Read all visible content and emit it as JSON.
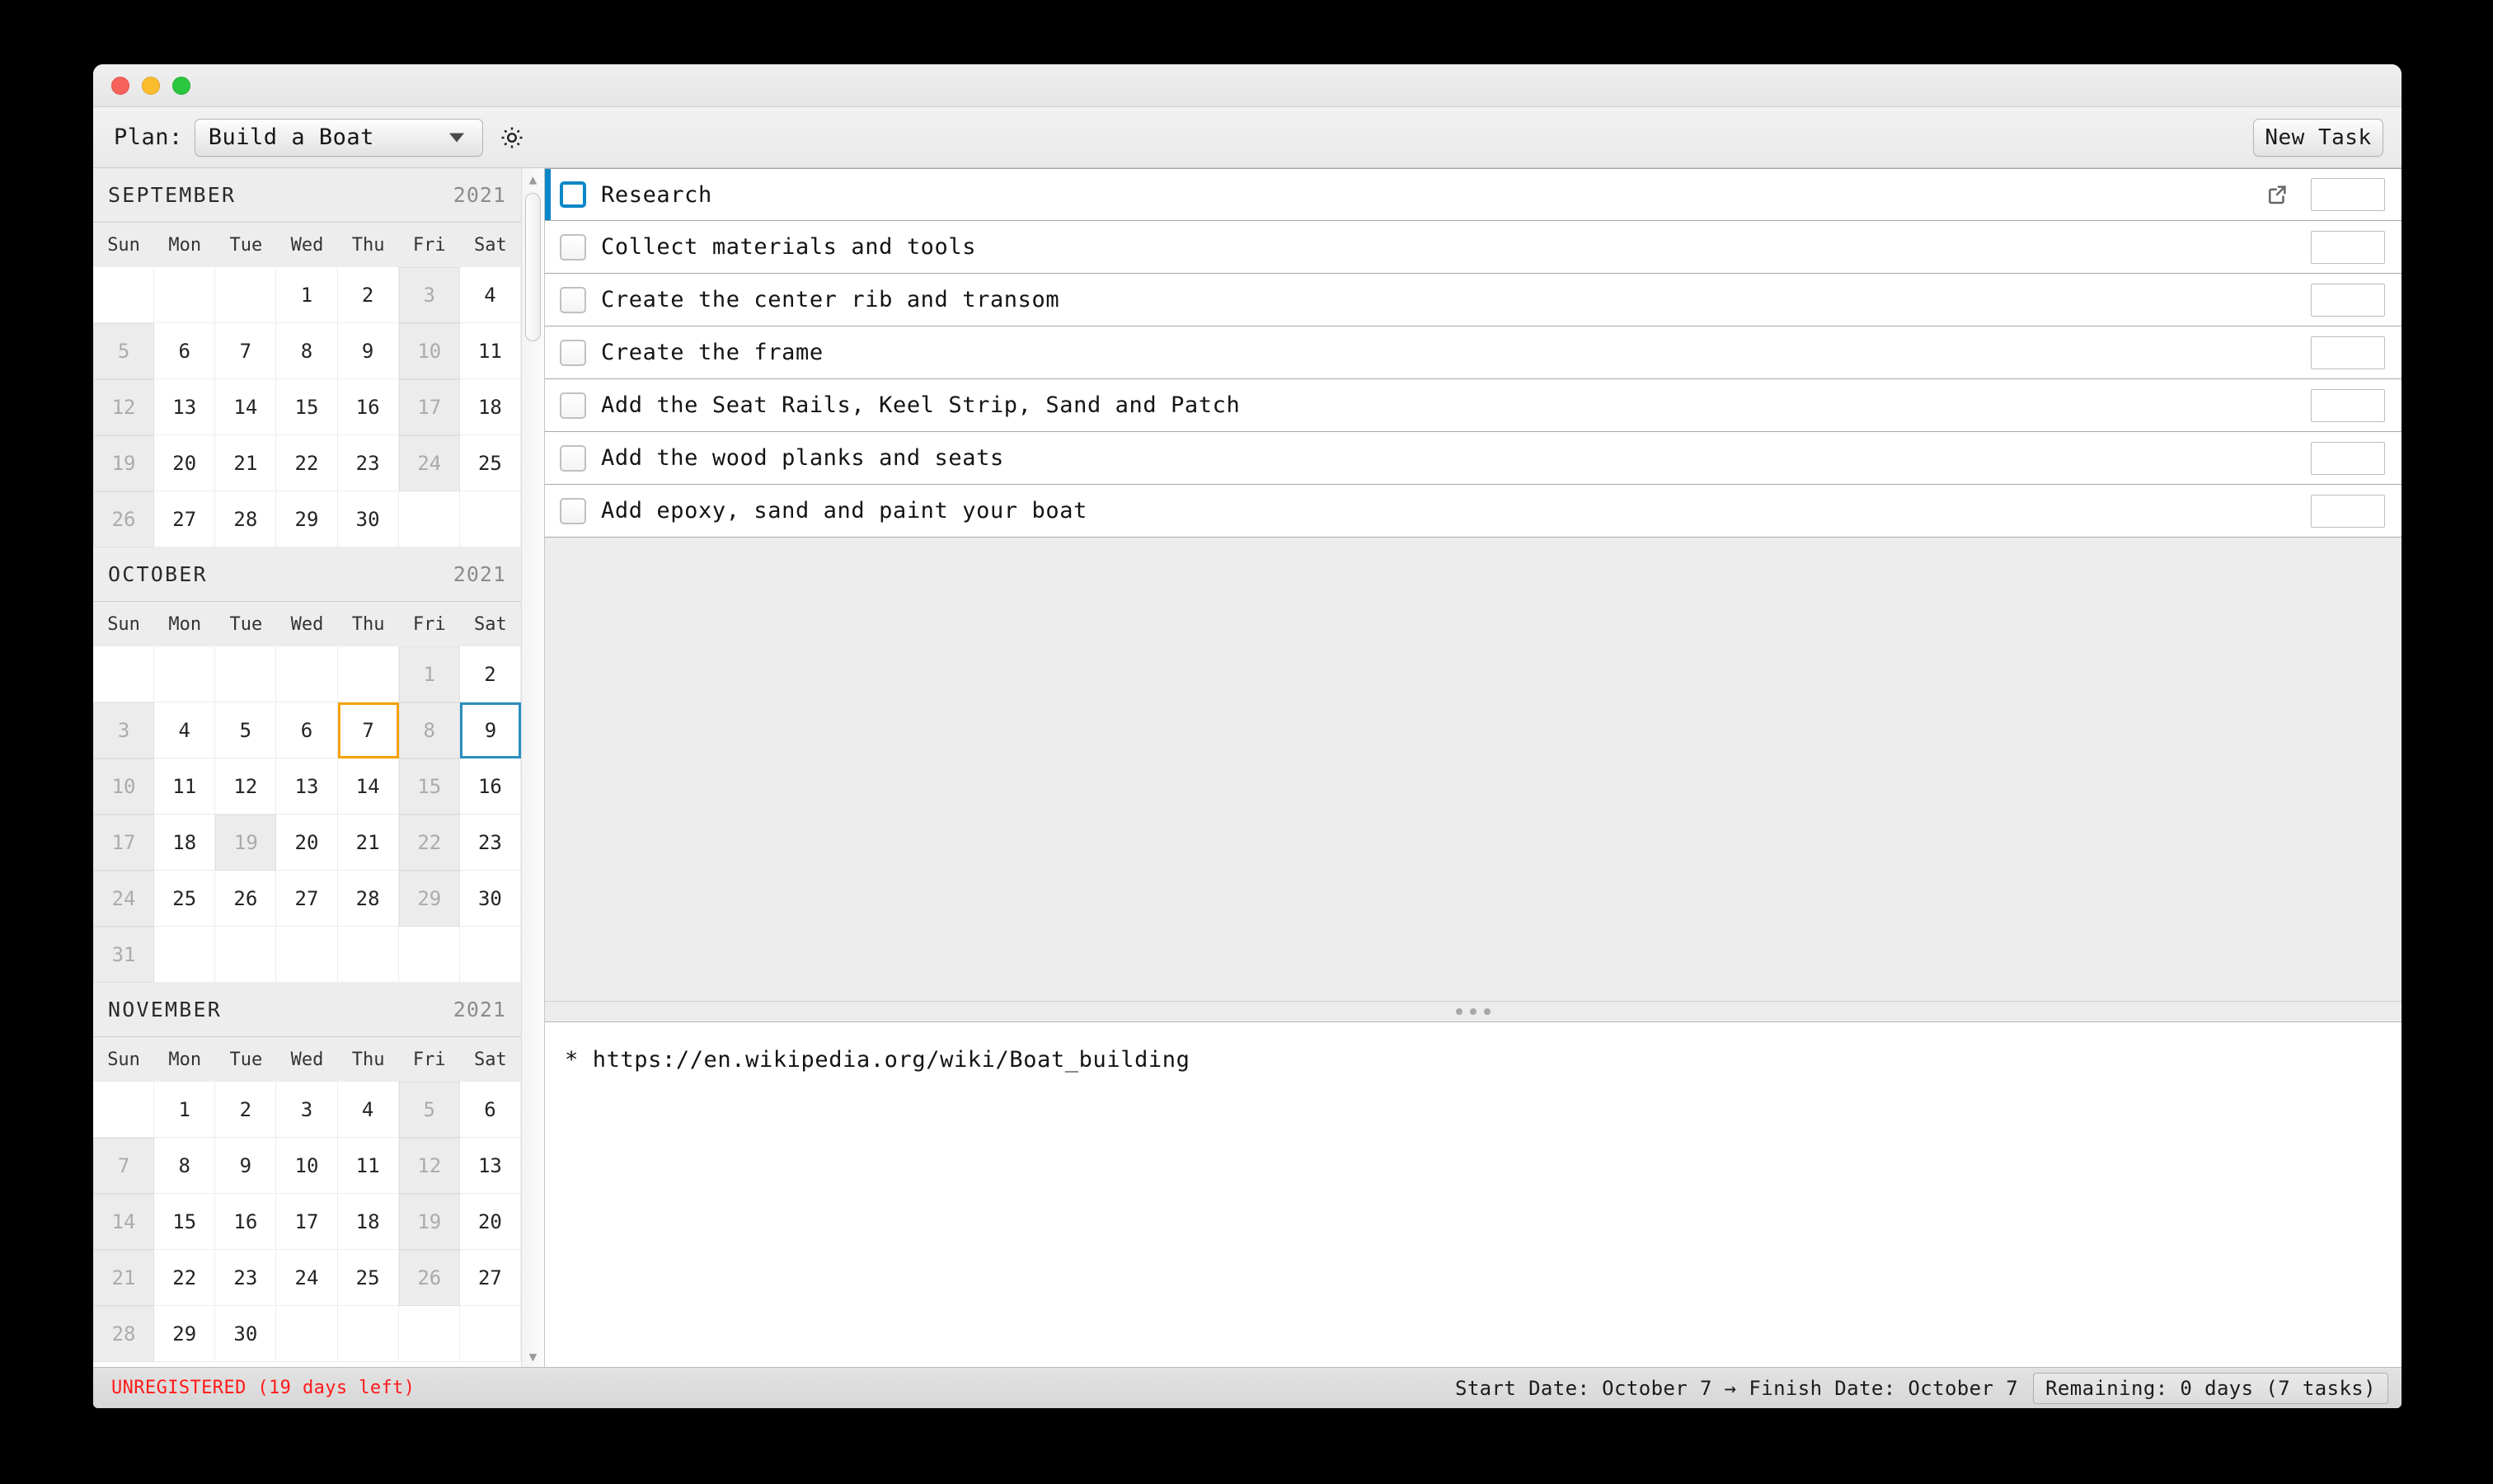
{
  "window": {
    "traffic_lights": [
      "close",
      "minimize",
      "zoom"
    ]
  },
  "toolbar": {
    "plan_label": "Plan:",
    "plan_value": "Build a Boat",
    "gear_icon": "gear-icon",
    "new_task_label": "New Task"
  },
  "tasks": [
    {
      "title": "Research",
      "selected": true,
      "has_link": true,
      "checked": false,
      "value": ""
    },
    {
      "title": "Collect materials and tools",
      "selected": false,
      "has_link": false,
      "checked": false,
      "value": ""
    },
    {
      "title": "Create the center rib and transom",
      "selected": false,
      "has_link": false,
      "checked": false,
      "value": ""
    },
    {
      "title": "Create the frame",
      "selected": false,
      "has_link": false,
      "checked": false,
      "value": ""
    },
    {
      "title": "Add the Seat Rails, Keel Strip, Sand and Patch",
      "selected": false,
      "has_link": false,
      "checked": false,
      "value": ""
    },
    {
      "title": "Add the wood planks and seats",
      "selected": false,
      "has_link": false,
      "checked": false,
      "value": ""
    },
    {
      "title": "Add epoxy, sand and paint your boat",
      "selected": false,
      "has_link": false,
      "checked": false,
      "value": ""
    }
  ],
  "notes": {
    "text": "* https://en.wikipedia.org/wiki/Boat_building"
  },
  "calendar": {
    "dow": [
      "Sun",
      "Mon",
      "Tue",
      "Wed",
      "Thu",
      "Fri",
      "Sat"
    ],
    "months": [
      {
        "name": "SEPTEMBER",
        "year": "2021",
        "weeks": [
          [
            {
              "d": ""
            },
            {
              "d": ""
            },
            {
              "d": ""
            },
            {
              "d": "1"
            },
            {
              "d": "2"
            },
            {
              "d": "3",
              "off": true
            },
            {
              "d": "4"
            }
          ],
          [
            {
              "d": "5",
              "off": true
            },
            {
              "d": "6"
            },
            {
              "d": "7"
            },
            {
              "d": "8"
            },
            {
              "d": "9"
            },
            {
              "d": "10",
              "off": true
            },
            {
              "d": "11"
            }
          ],
          [
            {
              "d": "12",
              "off": true
            },
            {
              "d": "13"
            },
            {
              "d": "14"
            },
            {
              "d": "15"
            },
            {
              "d": "16"
            },
            {
              "d": "17",
              "off": true
            },
            {
              "d": "18"
            }
          ],
          [
            {
              "d": "19",
              "off": true
            },
            {
              "d": "20"
            },
            {
              "d": "21"
            },
            {
              "d": "22"
            },
            {
              "d": "23"
            },
            {
              "d": "24",
              "off": true
            },
            {
              "d": "25"
            }
          ],
          [
            {
              "d": "26",
              "off": true
            },
            {
              "d": "27"
            },
            {
              "d": "28"
            },
            {
              "d": "29"
            },
            {
              "d": "30"
            },
            {
              "d": ""
            },
            {
              "d": ""
            }
          ]
        ]
      },
      {
        "name": "OCTOBER",
        "year": "2021",
        "weeks": [
          [
            {
              "d": ""
            },
            {
              "d": ""
            },
            {
              "d": ""
            },
            {
              "d": ""
            },
            {
              "d": ""
            },
            {
              "d": "1",
              "off": true
            },
            {
              "d": "2"
            }
          ],
          [
            {
              "d": "3",
              "off": true
            },
            {
              "d": "4"
            },
            {
              "d": "5"
            },
            {
              "d": "6"
            },
            {
              "d": "7",
              "start": true
            },
            {
              "d": "8",
              "off": true
            },
            {
              "d": "9",
              "finish": true
            }
          ],
          [
            {
              "d": "10",
              "off": true
            },
            {
              "d": "11"
            },
            {
              "d": "12"
            },
            {
              "d": "13"
            },
            {
              "d": "14"
            },
            {
              "d": "15",
              "off": true
            },
            {
              "d": "16"
            }
          ],
          [
            {
              "d": "17",
              "off": true
            },
            {
              "d": "18"
            },
            {
              "d": "19",
              "off": true
            },
            {
              "d": "20"
            },
            {
              "d": "21"
            },
            {
              "d": "22",
              "off": true
            },
            {
              "d": "23"
            }
          ],
          [
            {
              "d": "24",
              "off": true
            },
            {
              "d": "25"
            },
            {
              "d": "26"
            },
            {
              "d": "27"
            },
            {
              "d": "28"
            },
            {
              "d": "29",
              "off": true
            },
            {
              "d": "30"
            }
          ],
          [
            {
              "d": "31",
              "off": true
            },
            {
              "d": ""
            },
            {
              "d": ""
            },
            {
              "d": ""
            },
            {
              "d": ""
            },
            {
              "d": ""
            },
            {
              "d": ""
            }
          ]
        ]
      },
      {
        "name": "NOVEMBER",
        "year": "2021",
        "weeks": [
          [
            {
              "d": ""
            },
            {
              "d": "1"
            },
            {
              "d": "2"
            },
            {
              "d": "3"
            },
            {
              "d": "4"
            },
            {
              "d": "5",
              "off": true
            },
            {
              "d": "6"
            }
          ],
          [
            {
              "d": "7",
              "off": true
            },
            {
              "d": "8"
            },
            {
              "d": "9"
            },
            {
              "d": "10"
            },
            {
              "d": "11"
            },
            {
              "d": "12",
              "off": true
            },
            {
              "d": "13"
            }
          ],
          [
            {
              "d": "14",
              "off": true
            },
            {
              "d": "15"
            },
            {
              "d": "16"
            },
            {
              "d": "17"
            },
            {
              "d": "18"
            },
            {
              "d": "19",
              "off": true
            },
            {
              "d": "20"
            }
          ],
          [
            {
              "d": "21",
              "off": true
            },
            {
              "d": "22"
            },
            {
              "d": "23"
            },
            {
              "d": "24"
            },
            {
              "d": "25"
            },
            {
              "d": "26",
              "off": true
            },
            {
              "d": "27"
            }
          ],
          [
            {
              "d": "28",
              "off": true
            },
            {
              "d": "29"
            },
            {
              "d": "30"
            },
            {
              "d": ""
            },
            {
              "d": ""
            },
            {
              "d": ""
            },
            {
              "d": ""
            }
          ]
        ]
      }
    ]
  },
  "statusbar": {
    "unregistered": "UNREGISTERED (19 days left)",
    "dates": "Start Date: October 7 → Finish Date: October 7",
    "remaining": "Remaining: 0 days (7 tasks)"
  },
  "colors": {
    "accent_blue": "#0a87c7",
    "start_orange": "#f5a200",
    "finish_blue": "#2a8fc0",
    "warning_red": "#ff1a1a"
  }
}
